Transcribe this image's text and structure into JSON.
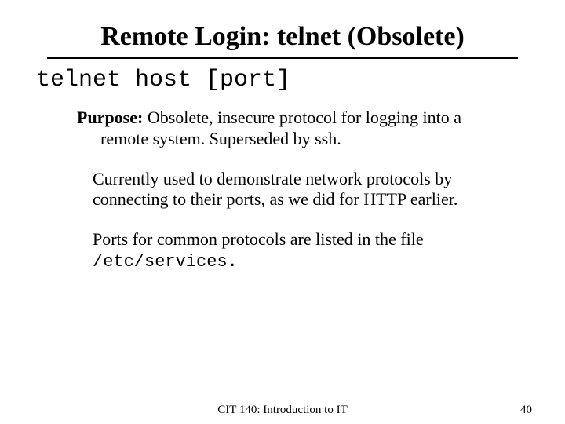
{
  "title": "Remote Login: telnet (Obsolete)",
  "command": "telnet host [port]",
  "purpose": {
    "label": "Purpose:",
    "line1": " Obsolete, insecure protocol for logging into a",
    "line2": "remote system.  Superseded by ssh."
  },
  "para1": "Currently used to demonstrate network protocols by connecting to their ports, as we did for HTTP earlier.",
  "para2_pre": "Ports for common protocols are listed in the file ",
  "para2_code": "/etc/services.",
  "footer": {
    "course": "CIT 140: Introduction to IT",
    "page": "40"
  }
}
